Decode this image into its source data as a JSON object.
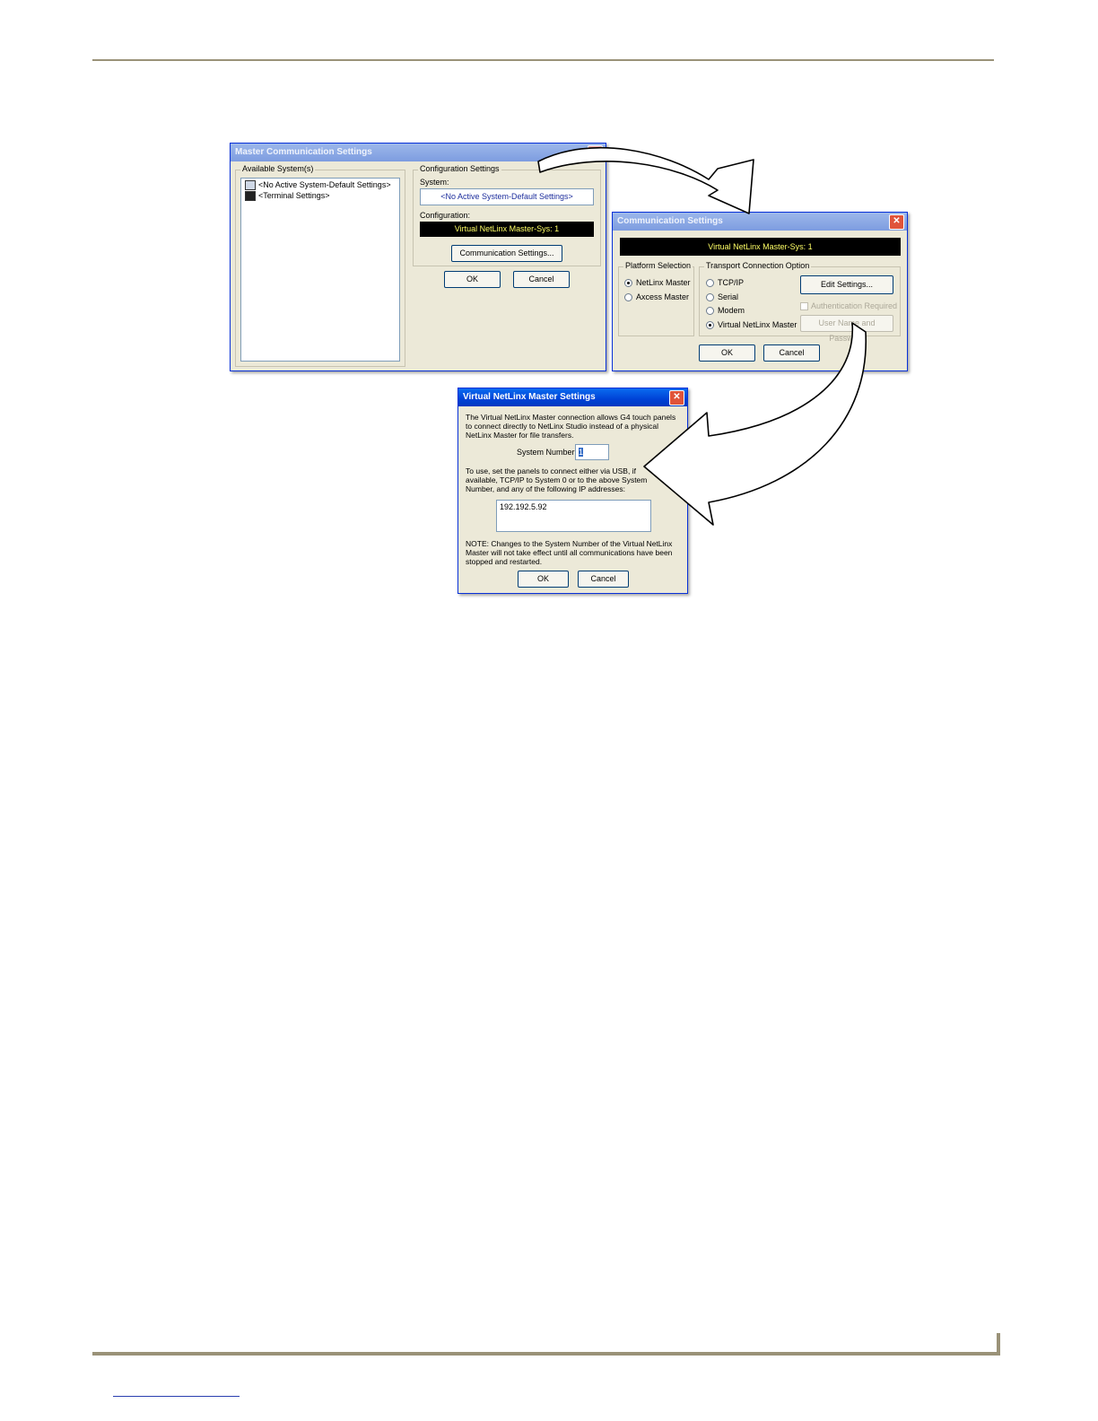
{
  "master_dialog": {
    "title": "Master Communication Settings",
    "available_label": "Available System(s)",
    "systems": [
      "<No Active System-Default Settings>",
      "<Terminal Settings>"
    ],
    "config_group_label": "Configuration Settings",
    "system_label": "System:",
    "system_value": "<No Active System-Default Settings>",
    "configuration_label": "Configuration:",
    "configuration_value": "Virtual NetLinx Master-Sys: 1",
    "comm_settings_button": "Communication Settings...",
    "ok": "OK",
    "cancel": "Cancel"
  },
  "comm_dialog": {
    "title": "Communication Settings",
    "header_value": "Virtual NetLinx Master-Sys: 1",
    "platform_label": "Platform Selection",
    "platform_options": [
      "NetLinx Master",
      "Axcess Master"
    ],
    "platform_selected": "NetLinx Master",
    "transport_label": "Transport Connection Option",
    "transport_options": [
      "TCP/IP",
      "Serial",
      "Modem",
      "Virtual NetLinx Master"
    ],
    "transport_selected": "Virtual NetLinx Master",
    "edit_settings": "Edit Settings...",
    "auth_required": "Authentication Required",
    "user_pass_button": "User Name and Password",
    "ok": "OK",
    "cancel": "Cancel"
  },
  "virtual_dialog": {
    "title": "Virtual NetLinx Master Settings",
    "intro": "The Virtual NetLinx Master connection allows G4 touch panels to connect directly to NetLinx Studio instead of a physical NetLinx Master for file transfers.",
    "system_number_label": "System Number:",
    "system_number_value": "1",
    "usage_text": "To use, set the panels to connect either via USB, if available, TCP/IP to System 0 or to the above System Number, and any of the following IP addresses:",
    "ip_address": "192.192.5.92",
    "note": "NOTE: Changes to the System Number of the Virtual NetLinx Master will not take effect until all communications have been stopped and restarted.",
    "ok": "OK",
    "cancel": "Cancel"
  },
  "colors": {
    "rule": "#9a9278",
    "xp_titlebar": "#0042d6",
    "dialog_face": "#ece9d8",
    "link": "#2a3fb0"
  }
}
